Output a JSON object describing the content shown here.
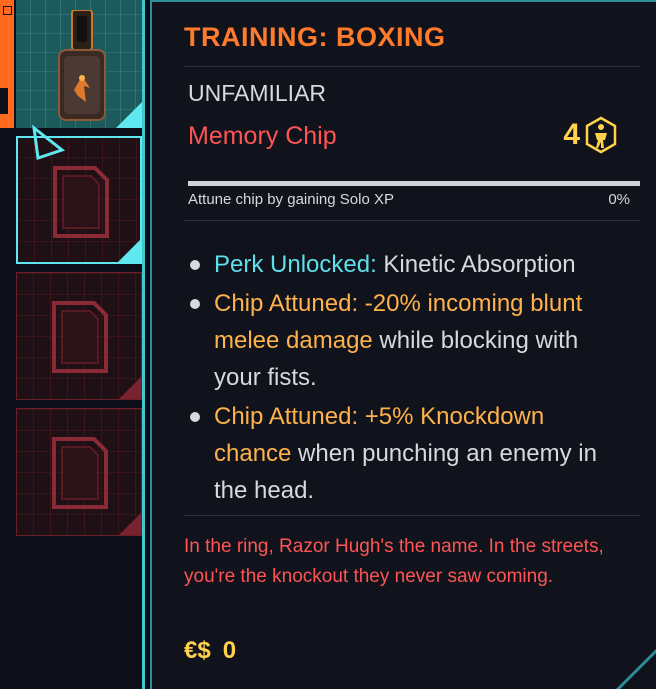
{
  "inventory": {
    "equipped_item_icon": "memory-chip-icon",
    "empty_slot_icon": "chip-slot-icon",
    "cursor_icon": "selection-triangle-icon"
  },
  "tooltip": {
    "title": "TRAINING: BOXING",
    "rarity": "UNFAMILIAR",
    "item_type": "Memory Chip",
    "capacity_cost": "4",
    "capacity_icon": "cyberware-capacity-icon",
    "progress": {
      "label": "Attune chip by gaining Solo XP",
      "value_text": "0%",
      "fraction": 0.0
    },
    "effects": [
      {
        "label": "Perk Unlocked:",
        "text": " Kinetic Absorption"
      },
      {
        "label": "Chip Attuned:",
        "value": " -20% incoming blunt melee damage",
        "text": " while blocking with your fists."
      },
      {
        "label": "Chip Attuned:",
        "value": " +5% Knockdown chance",
        "text": " when punching an enemy in the head."
      }
    ],
    "flavor_text": "In the ring, Razor Hugh's the name. In the streets, you're the knockout they never saw coming.",
    "price_currency": "€$",
    "price_value": "0"
  },
  "colors": {
    "title": "#ff7a2a",
    "item_type": "#ff5454",
    "perk_label": "#5ee0ea",
    "attuned": "#ffb24a",
    "capacity": "#ffd24a",
    "frame": "#3ec8cf"
  }
}
